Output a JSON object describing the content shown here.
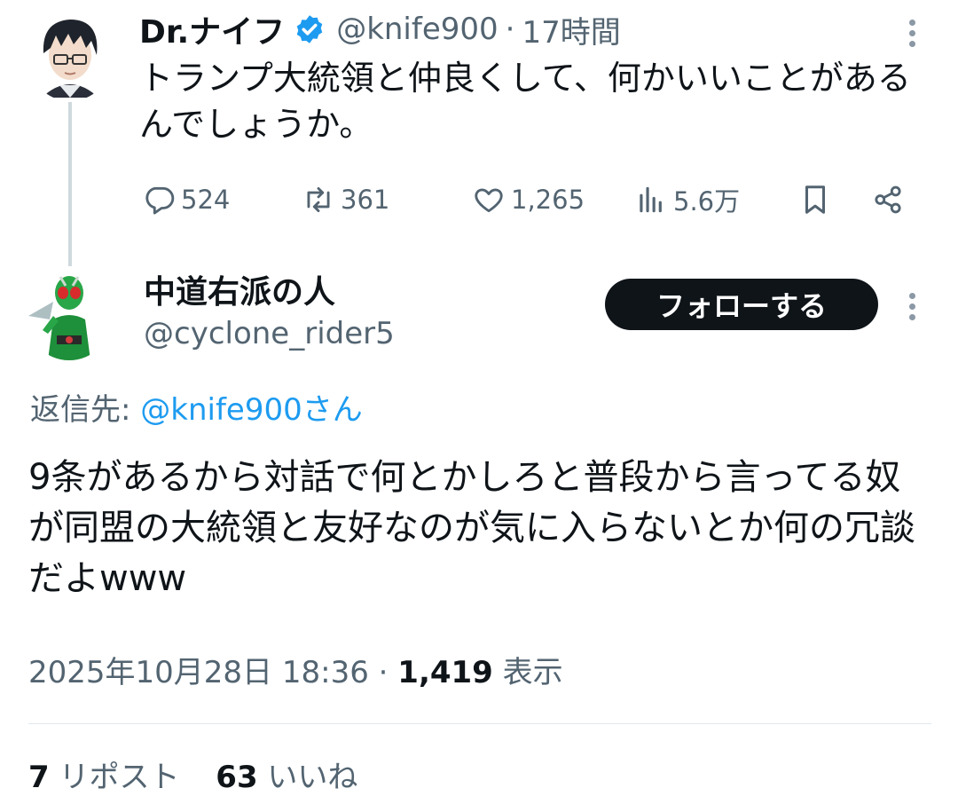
{
  "parent_tweet": {
    "display_name": "Dr.ナイフ",
    "handle": "@knife900",
    "separator": "·",
    "time": "17時間",
    "text": "トランプ大統領と仲良くして、何かいいことがあるんでしょうか。",
    "actions": {
      "replies": "524",
      "reposts": "361",
      "likes": "1,265",
      "views": "5.6万"
    },
    "icons": {
      "verified": "verified-badge-icon",
      "reply": "reply-icon",
      "repost": "repost-icon",
      "like": "heart-icon",
      "views": "views-bar-chart-icon",
      "bookmark": "bookmark-icon",
      "share": "share-icon",
      "more": "more-vertical-icon"
    }
  },
  "reply_tweet": {
    "display_name": "中道右派の人",
    "handle": "@cyclone_rider5",
    "follow_label": "フォローする",
    "reply_to_prefix": "返信先: ",
    "reply_to_handle": "@knife900さん",
    "text": "9条があるから対話で何とかしろと普段から言ってる奴が同盟の大統領と友好なのが気に入らないとか何の冗談だよwww",
    "timestamp": "2025年10月28日 18:36",
    "separator": " · ",
    "view_count": "1,419",
    "view_label": " 表示",
    "repost_count": "7",
    "repost_label": " リポスト",
    "like_count": "63",
    "like_label": " いいね"
  },
  "colors": {
    "text": "#0f1419",
    "muted": "#536471",
    "link": "#1d9bf0",
    "verified": "#1d9bf0",
    "follow_button_bg": "#0f1419",
    "thread_line": "#cfd9de"
  }
}
